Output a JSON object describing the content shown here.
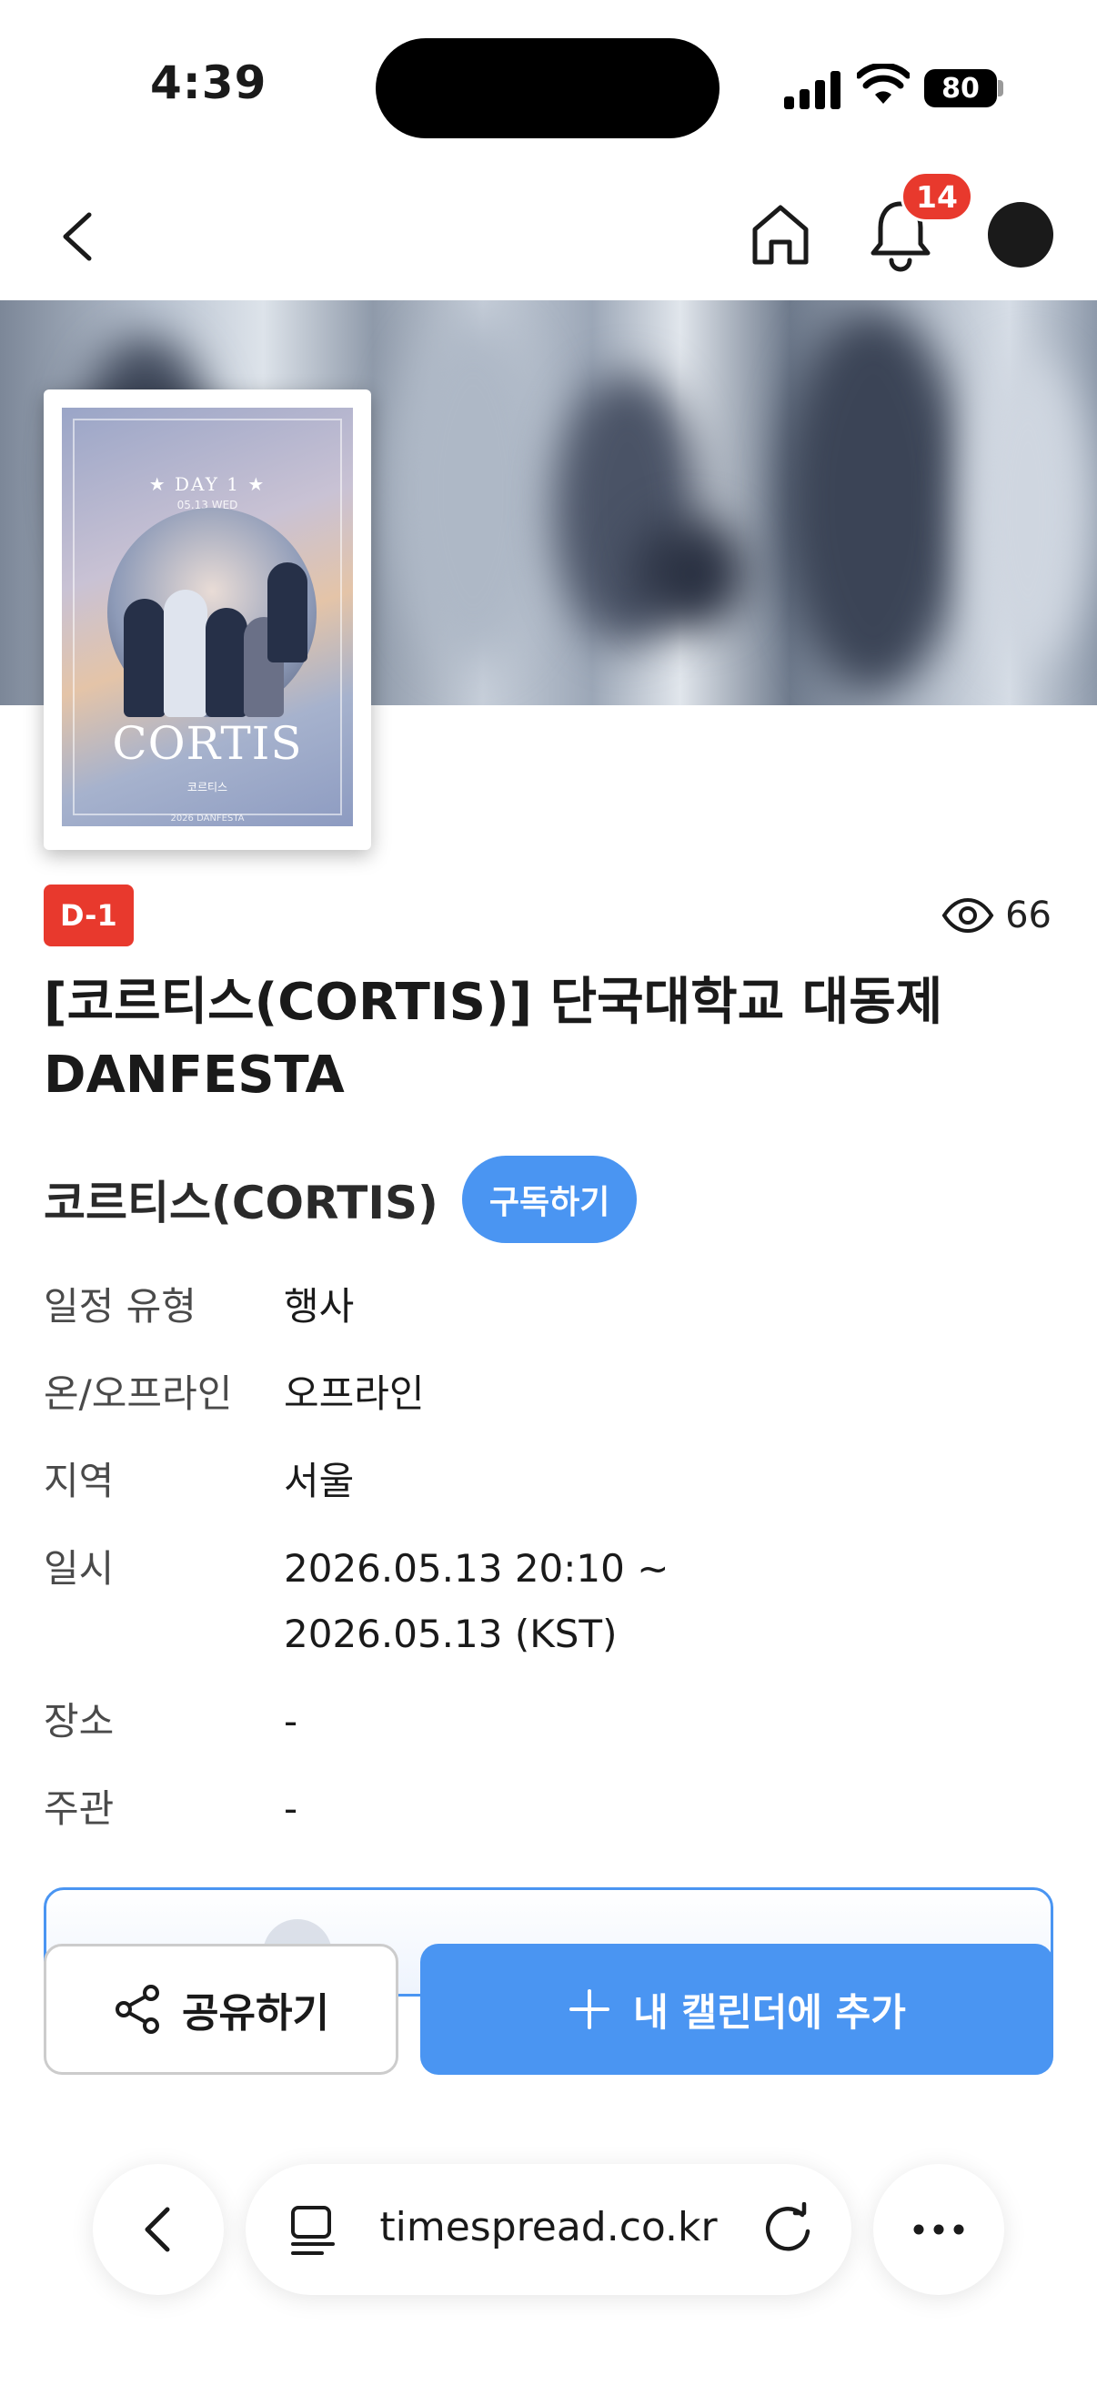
{
  "status_bar": {
    "time": "4:39",
    "battery": "80"
  },
  "top_nav": {
    "notification_count": "14"
  },
  "poster": {
    "day": "★ DAY 1 ★",
    "date": "05.13 WED",
    "title": "CORTIS",
    "subtitle": "코르티스",
    "footer": "2026 DANFESTA"
  },
  "event": {
    "dday_badge": "D-1",
    "views": "66",
    "title": "[코르티스(CORTIS)] 단국대학교 대동제 DANFESTA",
    "artist_name": "코르티스(CORTIS)",
    "subscribe_label": "구독하기"
  },
  "info": [
    {
      "label": "일정 유형",
      "value": "행사"
    },
    {
      "label": "온/오프라인",
      "value": "오프라인"
    },
    {
      "label": "지역",
      "value": "서울"
    },
    {
      "label": "일시",
      "value": "2026.05.13 20:10 ~\n2026.05.13 (KST)"
    },
    {
      "label": "장소",
      "value": "-"
    },
    {
      "label": "주관",
      "value": "-"
    }
  ],
  "actions": {
    "share_label": "공유하기",
    "calendar_label": "내 캘린더에 추가"
  },
  "browser": {
    "url": "timespread.co.kr"
  },
  "colors": {
    "accent_blue": "#4a95f2",
    "badge_red": "#e8392d"
  }
}
